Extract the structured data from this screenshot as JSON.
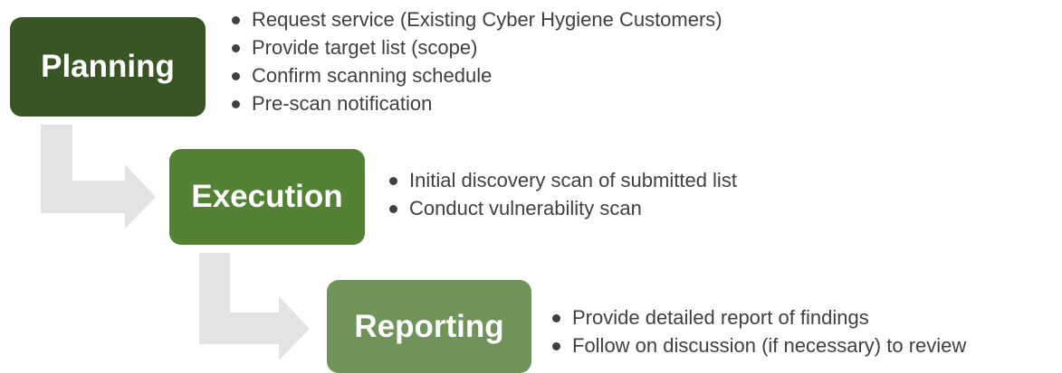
{
  "steps": [
    {
      "label": "Planning",
      "color": "#375623",
      "items": [
        "Request service (Existing Cyber Hygiene Customers)",
        "Provide target list (scope)",
        "Confirm scanning schedule",
        "Pre-scan notification"
      ]
    },
    {
      "label": "Execution",
      "color": "#548235",
      "items": [
        "Initial discovery scan of submitted list",
        "Conduct vulnerability scan"
      ]
    },
    {
      "label": "Reporting",
      "color": "#70935a",
      "items": [
        "Provide detailed report of findings",
        "Follow on discussion (if necessary) to review"
      ]
    }
  ],
  "connector_color": "#e3e3e3"
}
